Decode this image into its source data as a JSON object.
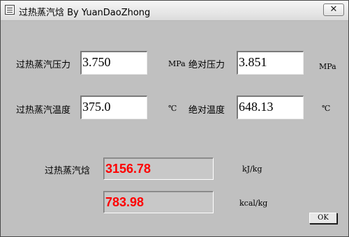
{
  "window": {
    "title": "过热蒸汽焓 By YuanDaoZhong",
    "close_symbol": "✕"
  },
  "inputs": {
    "superheated_pressure": {
      "label": "过热蒸汽压力",
      "value": "3.750",
      "unit": "MPa"
    },
    "absolute_pressure": {
      "label": "绝对压力",
      "value": "3.851",
      "unit": "MPa"
    },
    "superheated_temperature": {
      "label": "过热蒸汽温度",
      "value": "375.0",
      "unit": "℃"
    },
    "absolute_temperature": {
      "label": "绝对温度",
      "value": "648.13",
      "unit": "℃"
    }
  },
  "results": {
    "enthalpy_label": "过热蒸汽焓",
    "enthalpy_kj": {
      "value": "3156.78",
      "unit": "kJ/kg"
    },
    "enthalpy_kcal": {
      "value": "783.98",
      "unit": "kcal/kg"
    },
    "value_color": "#ff0000"
  },
  "buttons": {
    "ok_label": "OK"
  }
}
